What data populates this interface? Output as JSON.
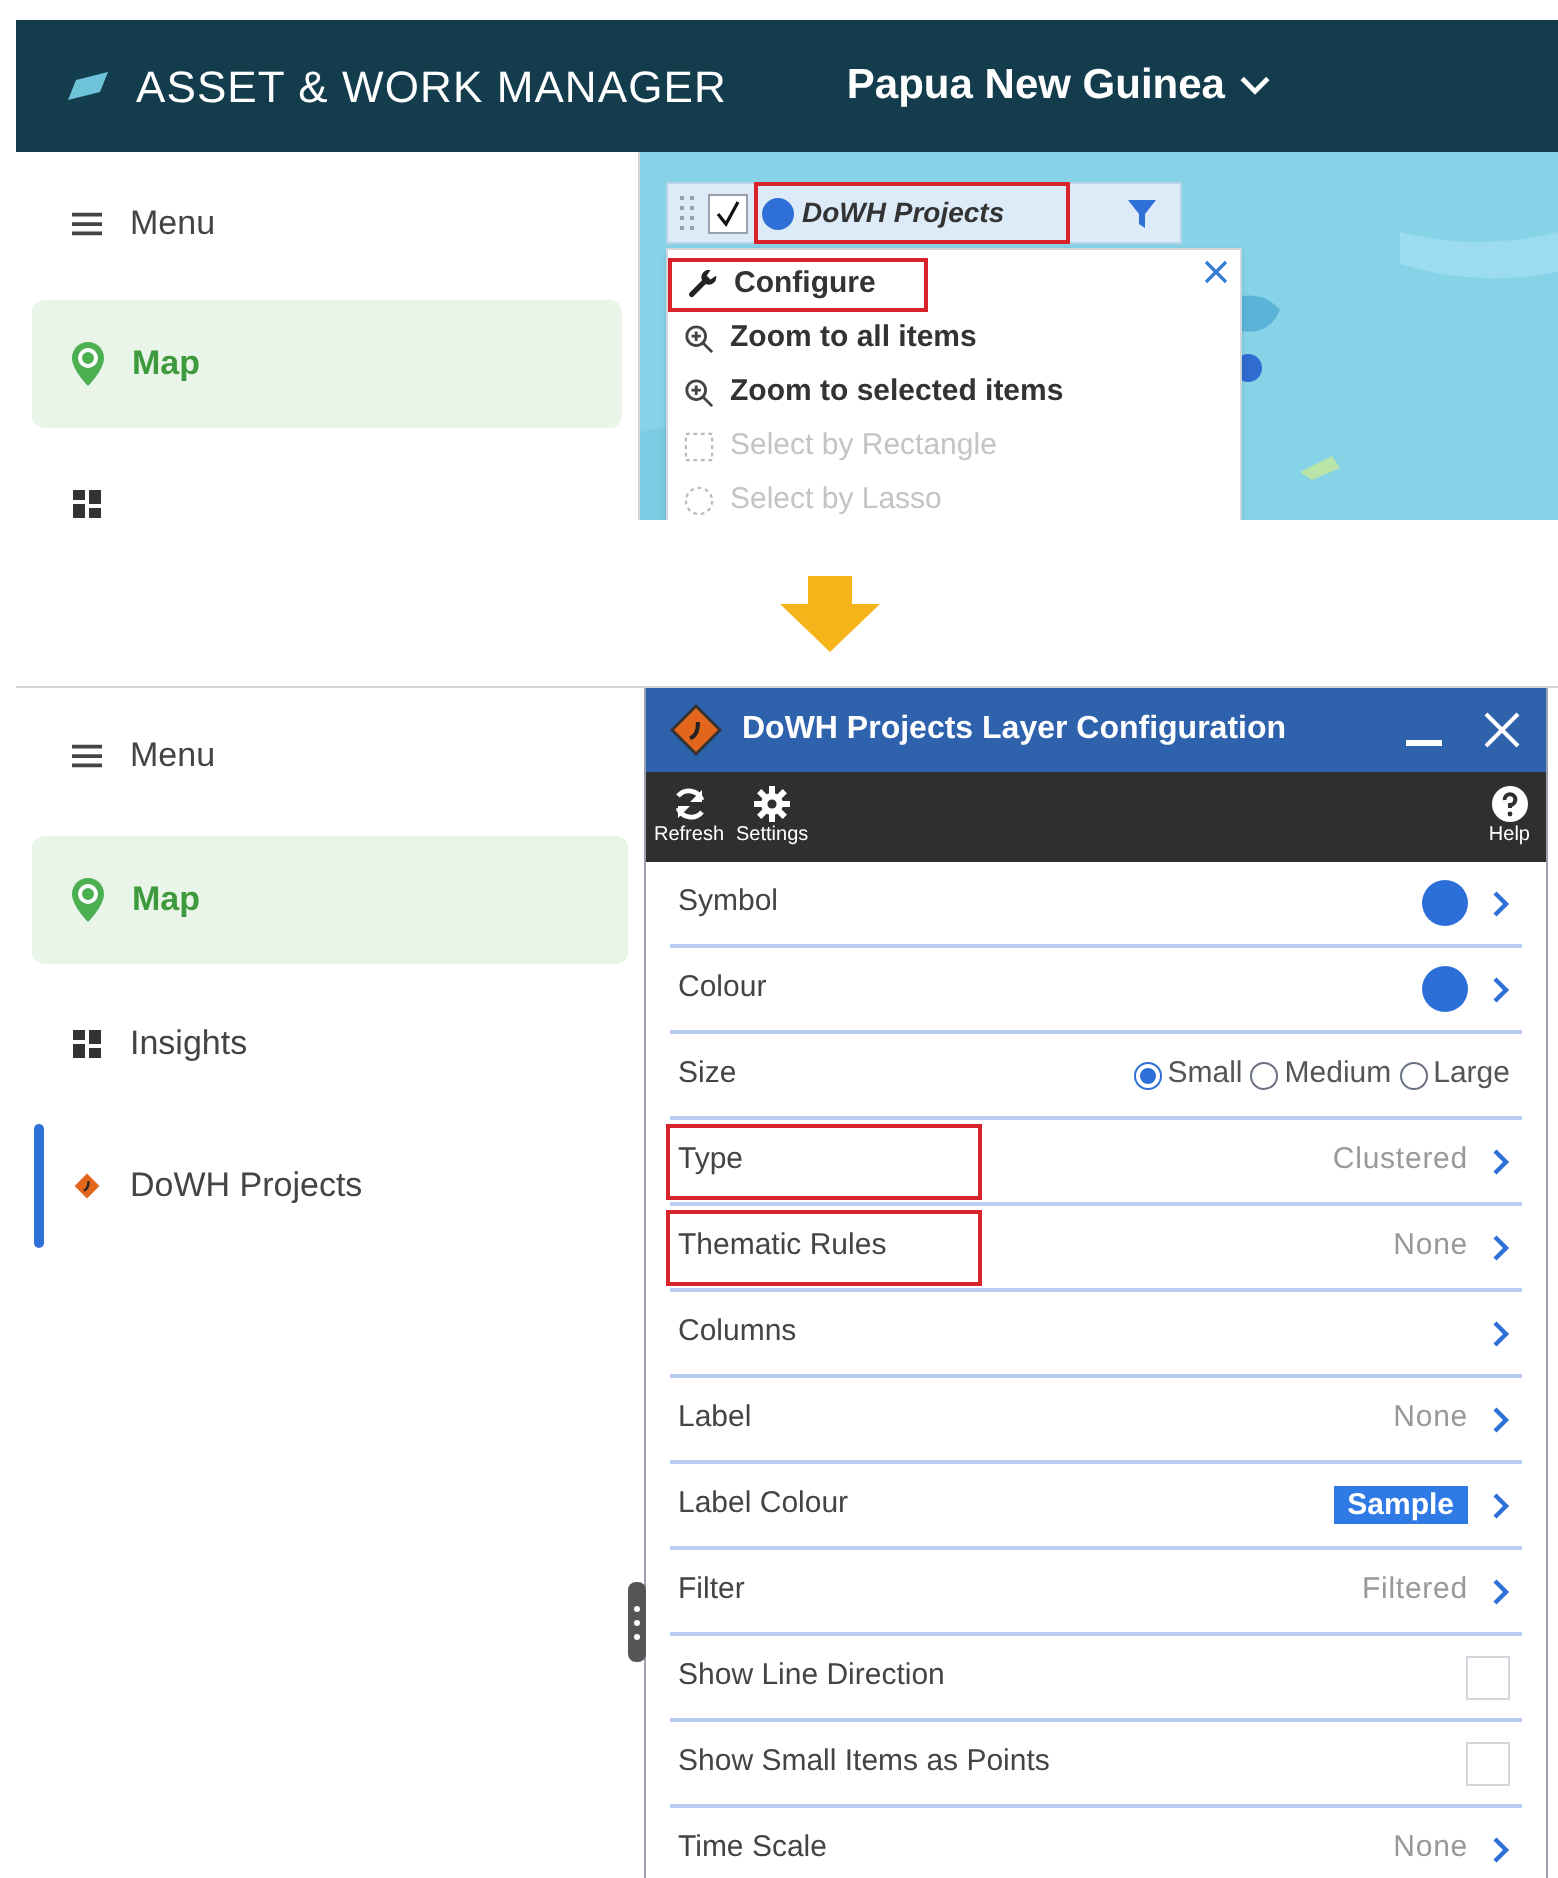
{
  "before": {
    "header": {
      "app_title": "ASSET & WORK MANAGER",
      "region": "Papua New Guinea"
    },
    "sidebar": [
      {
        "label": "Menu",
        "kind": "menu",
        "selected": false
      },
      {
        "label": "Map",
        "kind": "map",
        "selected": true
      },
      {
        "kind": "insights"
      }
    ],
    "layer": {
      "name": "DoWH Projects",
      "checked": true,
      "highlighted": true
    },
    "layer_menu": [
      {
        "label": "Configure",
        "kind": "wrench",
        "disabled": false,
        "highlighted": true
      },
      {
        "label": "Zoom to all items",
        "kind": "zoom",
        "disabled": false,
        "highlighted": false
      },
      {
        "label": "Zoom to selected items",
        "kind": "zoom",
        "disabled": false,
        "highlighted": false
      },
      {
        "label": "Select by Rectangle",
        "kind": "rectangle",
        "disabled": true,
        "highlighted": false
      },
      {
        "label": "Select by Lasso",
        "kind": "lasso",
        "disabled": true,
        "highlighted": false
      }
    ]
  },
  "after": {
    "sidebar": [
      {
        "label": "Menu",
        "kind": "menu",
        "selected": false,
        "panel_open": false
      },
      {
        "label": "Map",
        "kind": "map",
        "selected": true,
        "panel_open": false
      },
      {
        "label": "Insights",
        "kind": "insights",
        "selected": false,
        "panel_open": false
      },
      {
        "label": "DoWH Projects",
        "kind": "layer",
        "selected": false,
        "panel_open": true
      }
    ],
    "panel": {
      "title": "DoWH Projects Layer Configuration",
      "toolbar": [
        {
          "label": "Refresh",
          "kind": "refresh"
        },
        {
          "label": "Settings",
          "kind": "settings"
        },
        {
          "label": "Help",
          "kind": "help"
        }
      ],
      "rows": [
        {
          "label": "Symbol",
          "kind": "swatch",
          "highlighted": false
        },
        {
          "label": "Colour",
          "kind": "swatch",
          "highlighted": false
        },
        {
          "label": "Size",
          "kind": "radio",
          "highlighted": false,
          "options": [
            {
              "label": "Small",
              "selected": true
            },
            {
              "label": "Medium",
              "selected": false
            },
            {
              "label": "Large",
              "selected": false
            }
          ]
        },
        {
          "label": "Type",
          "kind": "value",
          "value": "Clustered",
          "highlighted": true
        },
        {
          "label": "Thematic Rules",
          "kind": "value",
          "value": "None",
          "highlighted": true
        },
        {
          "label": "Columns",
          "kind": "link",
          "highlighted": false
        },
        {
          "label": "Label",
          "kind": "value",
          "value": "None",
          "highlighted": false
        },
        {
          "label": "Label Colour",
          "kind": "sample",
          "value": "Sample",
          "highlighted": false
        },
        {
          "label": "Filter",
          "kind": "value",
          "value": "Filtered",
          "highlighted": false
        },
        {
          "label": "Show Line Direction",
          "kind": "checkbox",
          "checked": false,
          "highlighted": false
        },
        {
          "label": "Show Small Items as Points",
          "kind": "checkbox",
          "checked": false,
          "highlighted": false
        },
        {
          "label": "Time Scale",
          "kind": "value",
          "value": "None",
          "highlighted": false
        }
      ]
    }
  }
}
